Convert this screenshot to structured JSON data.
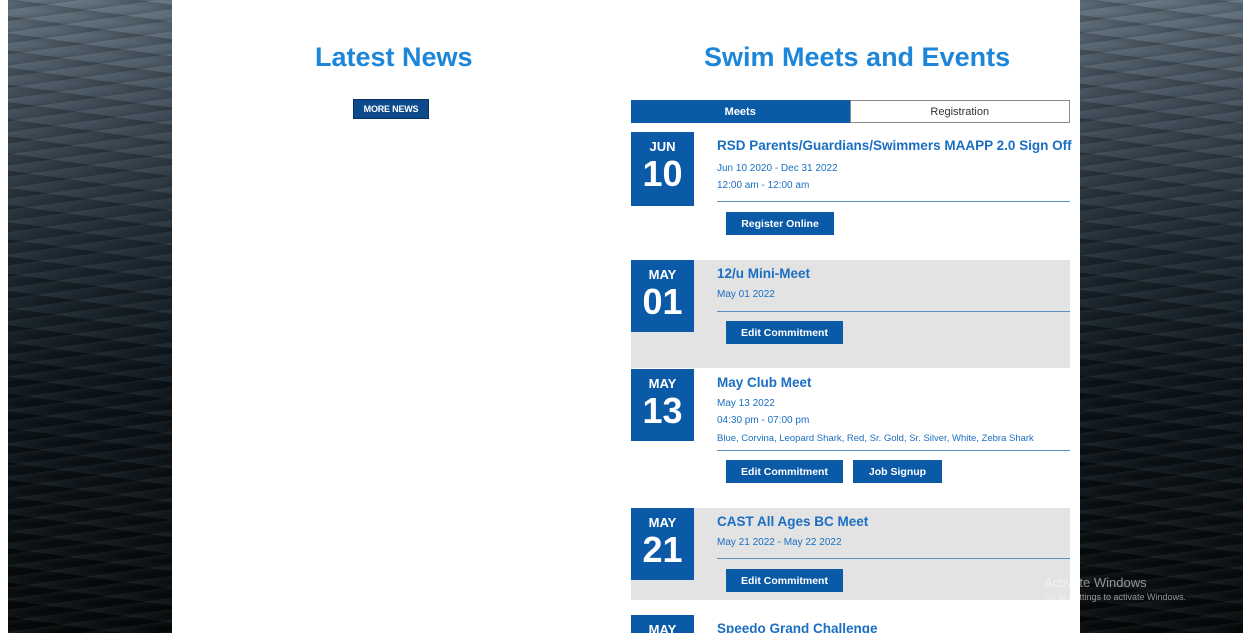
{
  "news": {
    "title": "Latest News",
    "more_label": "MORE NEWS"
  },
  "events": {
    "title": "Swim Meets and Events",
    "tabs": [
      {
        "label": "Meets"
      },
      {
        "label": "Registration"
      }
    ],
    "items": [
      {
        "month": "JUN",
        "day": "10",
        "title": "RSD Parents/Guardians/Swimmers MAAPP 2.0 Sign Off",
        "dates": "Jun 10 2020  -  Dec 31 2022",
        "time": "12:00 am  -  12:00 am",
        "buttons": [
          "Register Online"
        ]
      },
      {
        "month": "MAY",
        "day": "01",
        "title": "12/u Mini-Meet",
        "dates": "May 01 2022",
        "buttons": [
          "Edit Commitment"
        ]
      },
      {
        "month": "MAY",
        "day": "13",
        "title": "May Club Meet",
        "dates": "May 13 2022",
        "time": "04:30 pm  -  07:00 pm",
        "groups": "Blue, Corvina, Leopard Shark, Red, Sr. Gold, Sr. Silver, White, Zebra Shark",
        "buttons": [
          "Edit Commitment",
          "Job Signup"
        ]
      },
      {
        "month": "MAY",
        "day": "21",
        "title": "CAST All Ages BC Meet",
        "dates": "May 21 2022  -  May 22 2022",
        "buttons": [
          "Edit Commitment"
        ]
      },
      {
        "month": "MAY",
        "day": "",
        "title": "Speedo Grand Challenge"
      }
    ]
  },
  "watermark": {
    "line1": "Activate Windows",
    "line2": "Go to Settings to activate Windows."
  }
}
